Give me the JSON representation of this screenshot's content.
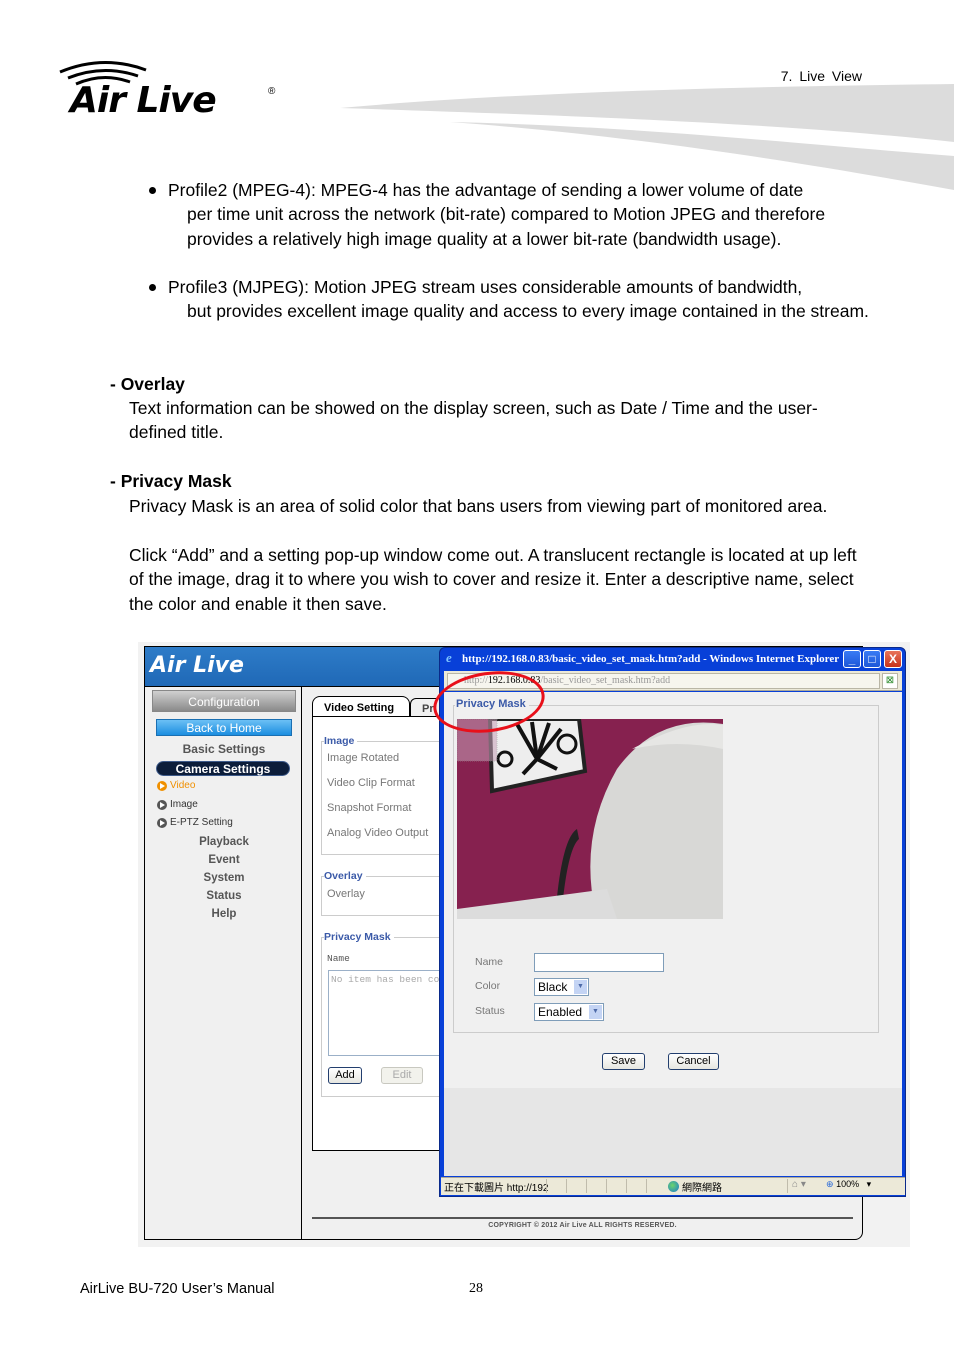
{
  "header": {
    "logo_text": "Air Live",
    "logo_registered": "®",
    "chapter": "7. Live View"
  },
  "bullets": [
    {
      "first": "Profile2 (MPEG-4): MPEG-4 has the advantage of sending a lower volume of date",
      "rest": "per time unit across the network (bit-rate) compared to Motion JPEG and therefore provides a relatively high image quality at a lower bit-rate (bandwidth usage)."
    },
    {
      "first": "Profile3 (MJPEG): Motion JPEG stream uses considerable amounts of bandwidth,",
      "rest": "but provides excellent image quality and access to every image contained in the stream."
    }
  ],
  "sections": {
    "overlay": {
      "heading": "- Overlay",
      "body": "Text information can be showed on the display screen, such as Date / Time and the user-defined title."
    },
    "privacy_mask": {
      "heading": "- Privacy Mask",
      "body1": "Privacy Mask is an area of solid color that bans users from viewing part of monitored area.",
      "body2": "Click “Add” and a setting pop-up window come out. A translucent rectangle is located at up left of the image, drag it to where you wish to cover and resize it. Enter a descriptive name, select the color and enable it then save."
    }
  },
  "screenshot": {
    "app": {
      "logo": "Air Live",
      "sidebar": {
        "configuration": "Configuration",
        "back_home": "Back to Home",
        "basic_settings": "Basic Settings",
        "camera_settings": "Camera Settings",
        "sub_items": [
          {
            "label": "Video",
            "icon": "play-circle-icon",
            "active": true
          },
          {
            "label": "Image",
            "icon": "play-circle-icon",
            "active": false
          },
          {
            "label": "E-PTZ Setting",
            "icon": "play-circle-icon",
            "active": false
          }
        ],
        "main_items": [
          "Playback",
          "Event",
          "System",
          "Status",
          "Help"
        ]
      },
      "tabs": [
        "Video Setting",
        "Pr"
      ],
      "image_section": {
        "legend": "Image",
        "items": [
          "Image Rotated",
          "Video Clip Format",
          "Snapshot Format",
          "Analog Video Output"
        ]
      },
      "overlay_section": {
        "legend": "Overlay",
        "items": [
          "Overlay"
        ]
      },
      "privacy_section": {
        "legend": "Privacy Mask",
        "name_header": "Name",
        "list_placeholder": "No item has been co",
        "add_label": "Add",
        "edit_label": "Edit"
      },
      "copyright": "COPYRIGHT © 2012 Air Live ALL RIGHTS RESERVED."
    },
    "popup": {
      "title": "http://192.168.0.83/basic_video_set_mask.htm?add - Windows Internet Explorer",
      "address_prefix": "http://",
      "address_host": "192.168.0.83",
      "address_path": "/basic_video_set_mask.htm?add",
      "window_buttons": {
        "minimize": "_",
        "maximize": "□",
        "close": "X"
      },
      "legend": "Privacy Mask",
      "form": {
        "name_label": "Name",
        "name_value": "",
        "color_label": "Color",
        "color_value": "Black",
        "status_label": "Status",
        "status_value": "Enabled"
      },
      "save_label": "Save",
      "cancel_label": "Cancel",
      "status_bar": {
        "text": "正在下載圖片 http://192",
        "zone": "網際網路",
        "zoom": "100%"
      }
    }
  },
  "footer": {
    "manual": "AirLive BU-720 User’s Manual",
    "page": "28"
  }
}
